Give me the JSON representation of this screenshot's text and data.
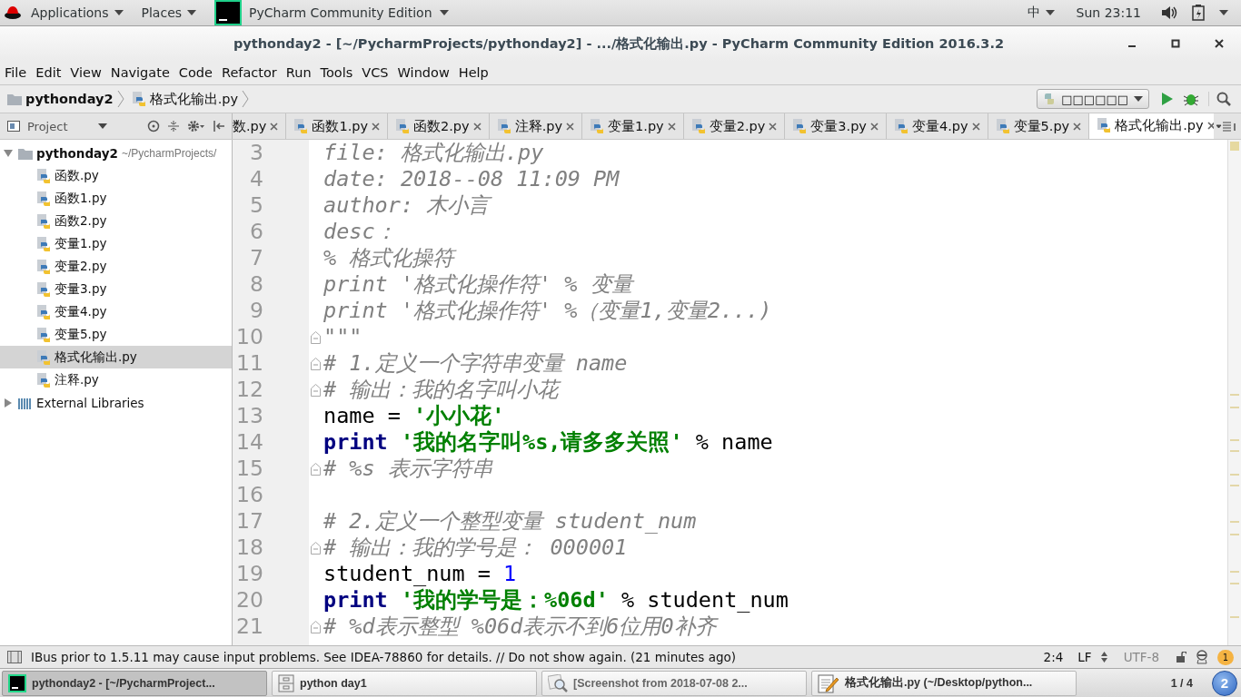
{
  "top_panel": {
    "menus": [
      "Applications",
      "Places"
    ],
    "app": "PyCharm Community Edition",
    "input_method": "中",
    "clock": "Sun 23:11"
  },
  "window": {
    "title": "pythonday2 - [~/PycharmProjects/pythonday2] - .../格式化输出.py - PyCharm Community Edition 2016.3.2"
  },
  "menu": [
    "File",
    "Edit",
    "View",
    "Navigate",
    "Code",
    "Refactor",
    "Run",
    "Tools",
    "VCS",
    "Window",
    "Help"
  ],
  "breadcrumbs": [
    {
      "label": "pythonday2",
      "kind": "folder"
    },
    {
      "label": "格式化输出.py",
      "kind": "file"
    }
  ],
  "run_config": "□□□□□□",
  "project_panel": {
    "title": "Project"
  },
  "tabs": [
    {
      "label": "数.py",
      "selected": false
    },
    {
      "label": "函数1.py",
      "selected": false
    },
    {
      "label": "函数2.py",
      "selected": false
    },
    {
      "label": "注释.py",
      "selected": false
    },
    {
      "label": "变量1.py",
      "selected": false
    },
    {
      "label": "变量2.py",
      "selected": false
    },
    {
      "label": "变量3.py",
      "selected": false
    },
    {
      "label": "变量4.py",
      "selected": false
    },
    {
      "label": "变量5.py",
      "selected": false
    },
    {
      "label": "格式化输出.py",
      "selected": true
    }
  ],
  "tree": [
    {
      "label": "pythonday2",
      "path": "~/PycharmProjects/",
      "kind": "folder",
      "expanded": true,
      "children": [
        {
          "label": "函数.py",
          "kind": "file",
          "selected": false
        },
        {
          "label": "函数1.py",
          "kind": "file",
          "selected": false
        },
        {
          "label": "函数2.py",
          "kind": "file",
          "selected": false
        },
        {
          "label": "变量1.py",
          "kind": "file",
          "selected": false
        },
        {
          "label": "变量2.py",
          "kind": "file",
          "selected": false
        },
        {
          "label": "变量3.py",
          "kind": "file",
          "selected": false
        },
        {
          "label": "变量4.py",
          "kind": "file",
          "selected": false
        },
        {
          "label": "变量5.py",
          "kind": "file",
          "selected": false
        },
        {
          "label": "格式化输出.py",
          "kind": "file",
          "selected": true
        },
        {
          "label": "注释.py",
          "kind": "file",
          "selected": false
        }
      ]
    },
    {
      "label": "External Libraries",
      "kind": "library",
      "expanded": false
    }
  ],
  "editor": {
    "lines": [
      {
        "number": "3",
        "fold": false,
        "tokens": [
          {
            "kind": "doc",
            "text": "file: 格式化输出.py"
          }
        ]
      },
      {
        "number": "4",
        "fold": false,
        "tokens": [
          {
            "kind": "doc",
            "text": "date: 2018--08 11:09 PM"
          }
        ]
      },
      {
        "number": "5",
        "fold": false,
        "tokens": [
          {
            "kind": "doc",
            "text": "author: 木小言"
          }
        ]
      },
      {
        "number": "6",
        "fold": false,
        "tokens": [
          {
            "kind": "doc",
            "text": "desc："
          }
        ]
      },
      {
        "number": "7",
        "fold": false,
        "tokens": [
          {
            "kind": "doc",
            "text": "% 格式化操符"
          }
        ]
      },
      {
        "number": "8",
        "fold": false,
        "tokens": [
          {
            "kind": "doc",
            "text": "print '格式化操作符' % 变量"
          }
        ]
      },
      {
        "number": "9",
        "fold": false,
        "tokens": [
          {
            "kind": "doc",
            "text": "print '格式化操作符' %（变量1,变量2...)"
          }
        ]
      },
      {
        "number": "10",
        "fold": true,
        "tokens": [
          {
            "kind": "doc",
            "text": "\"\"\""
          }
        ]
      },
      {
        "number": "11",
        "fold": true,
        "tokens": [
          {
            "kind": "comment",
            "text": "# 1.定义一个字符串变量 name"
          }
        ]
      },
      {
        "number": "12",
        "fold": true,
        "tokens": [
          {
            "kind": "comment",
            "text": "# 输出：我的名字叫小花"
          }
        ]
      },
      {
        "number": "13",
        "fold": false,
        "tokens": [
          {
            "kind": "plain",
            "text": "name = "
          },
          {
            "kind": "string",
            "text": "'小小花'"
          }
        ]
      },
      {
        "number": "14",
        "fold": false,
        "tokens": [
          {
            "kind": "keyword",
            "text": "print"
          },
          {
            "kind": "string",
            "text": " '我的名字叫%s,请多多关照'"
          },
          {
            "kind": "plain",
            "text": " % name"
          }
        ]
      },
      {
        "number": "15",
        "fold": true,
        "tokens": [
          {
            "kind": "comment",
            "text": "# %s 表示字符串"
          }
        ]
      },
      {
        "number": "16",
        "fold": false
      },
      {
        "number": "17",
        "fold": false,
        "tokens": [
          {
            "kind": "comment",
            "text": "# 2.定义一个整型变量 student_num"
          }
        ]
      },
      {
        "number": "18",
        "fold": true,
        "tokens": [
          {
            "kind": "comment",
            "text": "# 输出：我的学号是： 000001"
          }
        ]
      },
      {
        "number": "19",
        "fold": false,
        "tokens": [
          {
            "kind": "plain",
            "text": "student_num = "
          },
          {
            "kind": "number",
            "text": "1"
          }
        ]
      },
      {
        "number": "20",
        "fold": false,
        "tokens": [
          {
            "kind": "keyword",
            "text": "print"
          },
          {
            "kind": "string",
            "text": " '我的学号是：%06d'"
          },
          {
            "kind": "plain",
            "text": " % student_num"
          }
        ]
      },
      {
        "number": "21",
        "fold": true,
        "tokens": [
          {
            "kind": "comment",
            "text": "# %d表示整型 %06d表示不到6位用0补齐"
          }
        ]
      }
    ]
  },
  "status_bar": {
    "message": "IBus prior to 1.5.11 may cause input problems. See IDEA-78860 for details. // Do not show again. (21 minutes ago)",
    "position": "2:4",
    "line_separator": "LF",
    "encoding": "UTF-8",
    "notifications": "1"
  },
  "taskbar": {
    "items": [
      {
        "label": "pythonday2 - [~/PycharmProject...",
        "kind": "pycharm",
        "selected": true
      },
      {
        "label": "python day1",
        "kind": "folder",
        "selected": false
      },
      {
        "label": "[Screenshot from 2018-07-08 2...",
        "kind": "viewer",
        "selected": false
      },
      {
        "label": "格式化输出.py (~/Desktop/python...",
        "kind": "editor",
        "selected": false
      }
    ],
    "workspace": "1 / 4",
    "badge": "2"
  }
}
